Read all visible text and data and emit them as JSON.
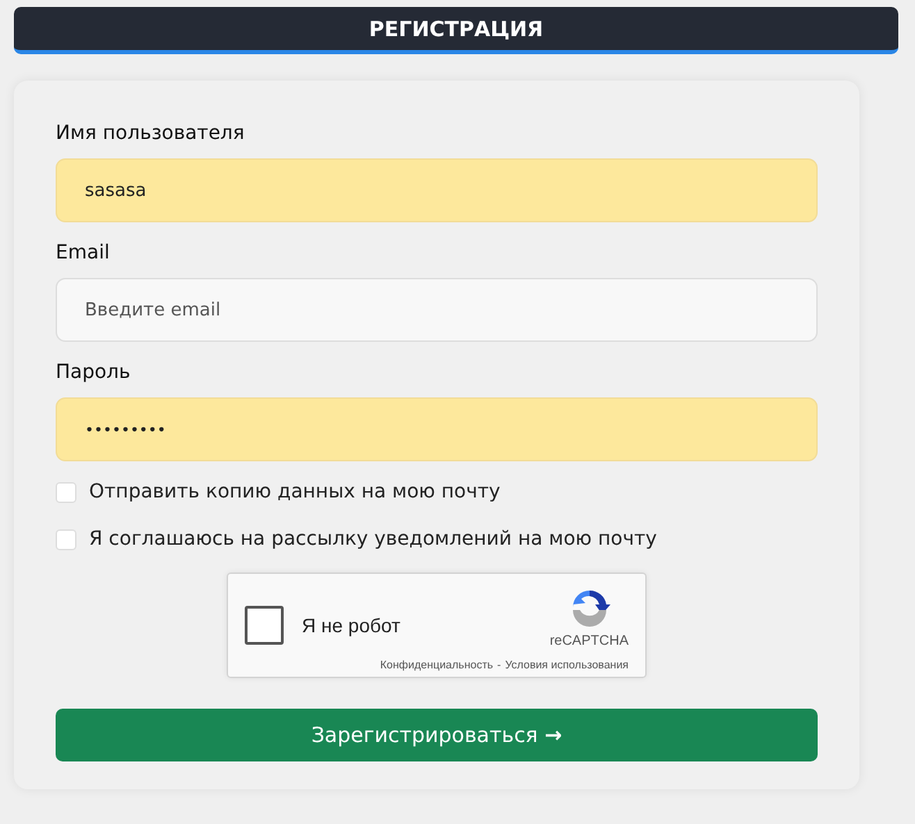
{
  "header": {
    "title": "РЕГИСТРАЦИЯ"
  },
  "fields": [
    {
      "label": "Имя пользователя",
      "value": "sasasa",
      "kind": "text",
      "autofilled": true
    },
    {
      "label": "Email",
      "placeholder": "Введите email",
      "kind": "text",
      "autofilled": false
    },
    {
      "label": "Пароль",
      "value": "•••••••••",
      "kind": "password",
      "autofilled": true
    }
  ],
  "checkboxes": [
    {
      "label": "Отправить копию данных на мою почту",
      "checked": false
    },
    {
      "label": "Я соглашаюсь на рассылку уведомлений на мою почту",
      "checked": false
    }
  ],
  "captcha": {
    "label": "Я не робот",
    "checked": false,
    "brand": "reCAPTCHA",
    "links": [
      "Конфиденциальность",
      "Условия использования"
    ],
    "separator": "-"
  },
  "submit": {
    "label": "Зарегистрироваться",
    "arrow": "→"
  }
}
